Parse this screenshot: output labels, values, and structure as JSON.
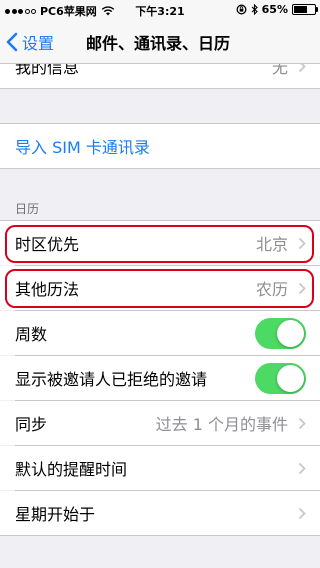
{
  "status_bar": {
    "carrier": "PC6苹果网",
    "time": "下午3:21",
    "battery_percent": "65%",
    "battery_level": 0.65,
    "signal_icon": "signal-dots-icon",
    "wifi_icon": "wifi-icon",
    "rotation_lock_icon": "rotation-lock-icon",
    "bluetooth_icon": "bluetooth-icon"
  },
  "nav": {
    "back_label": "设置",
    "title": "邮件、通讯录、日历"
  },
  "rows": {
    "my_info": {
      "label": "我的信息",
      "value": "无"
    },
    "import_sim": {
      "label": "导入 SIM 卡通讯录"
    },
    "calendar_header": "日历",
    "timezone": {
      "label": "时区优先",
      "value": "北京"
    },
    "alt_calendar": {
      "label": "其他历法",
      "value": "农历"
    },
    "week_numbers": {
      "label": "周数",
      "on": true
    },
    "show_declined": {
      "label": "显示被邀请人已拒绝的邀请",
      "on": true
    },
    "sync": {
      "label": "同步",
      "value": "过去 1 个月的事件"
    },
    "default_alert": {
      "label": "默认的提醒时间"
    },
    "week_start": {
      "label": "星期开始于"
    }
  },
  "colors": {
    "accent": "#1a7cf5",
    "toggle_on": "#4cd964",
    "highlight": "#d9001b",
    "background": "#efeff4"
  }
}
